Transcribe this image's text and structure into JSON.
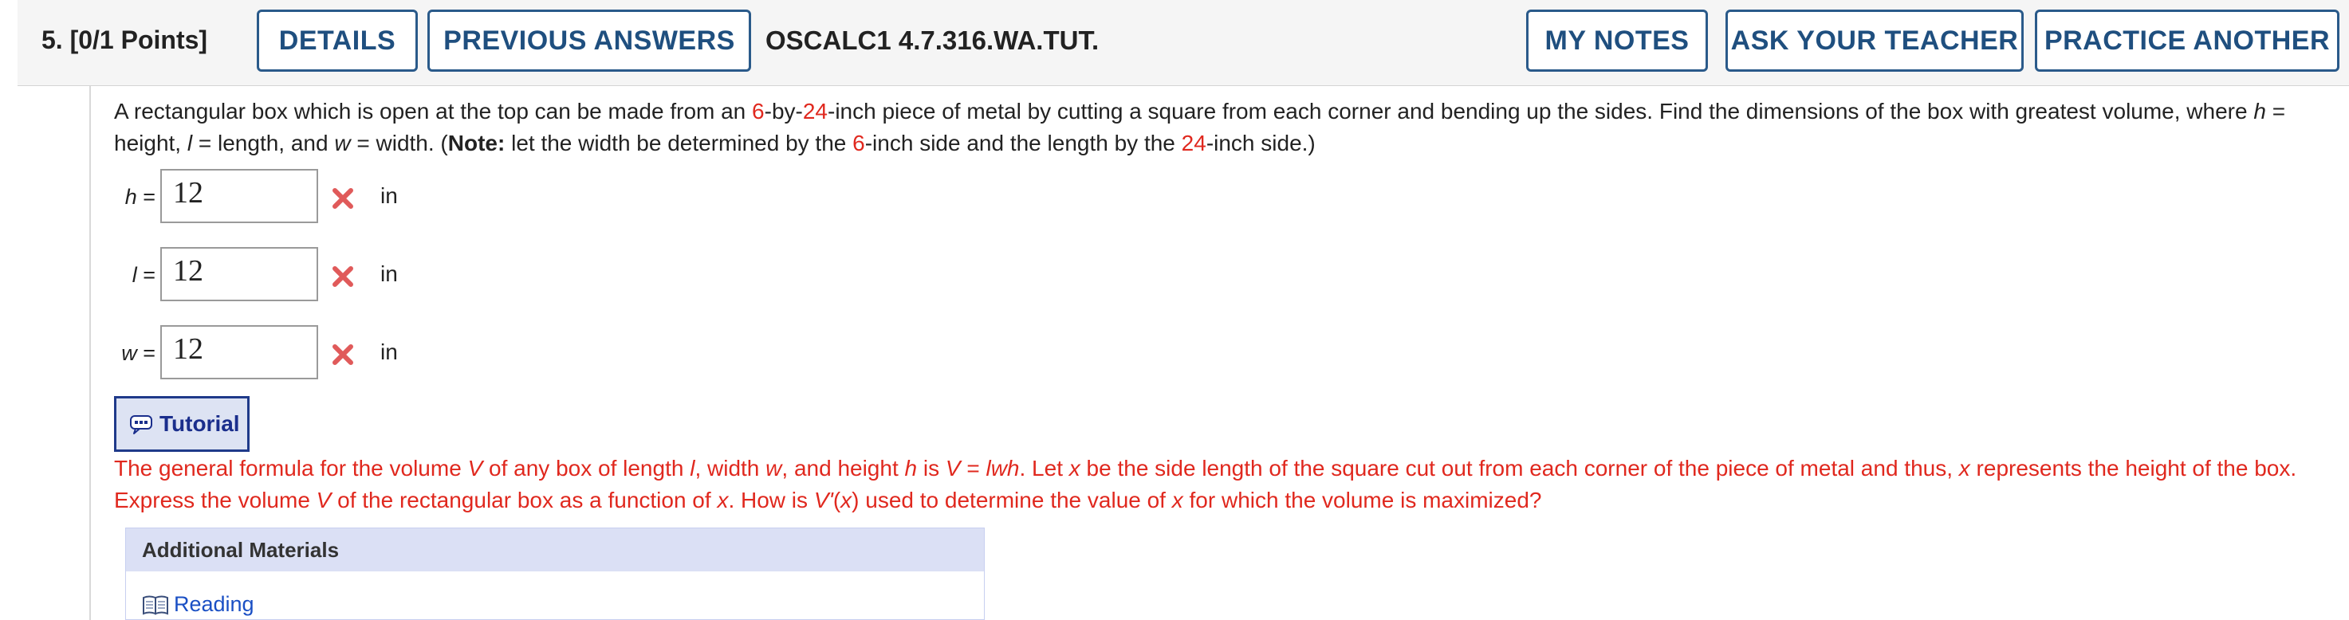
{
  "header": {
    "question_number": "5.",
    "points": "[0/1 Points]",
    "details_label": "DETAILS",
    "previous_answers_label": "PREVIOUS ANSWERS",
    "assignment_code": "OSCALC1 4.7.316.WA.TUT.",
    "my_notes_label": "MY NOTES",
    "ask_teacher_label": "ASK YOUR TEACHER",
    "practice_another_label": "PRACTICE ANOTHER"
  },
  "question": {
    "t1": "A rectangular box which is open at the top can be made from an ",
    "n6a": "6",
    "t2": "-by-",
    "n24a": "24",
    "t3": "-inch piece of metal by cutting a square from each corner and bending up the sides. Find the dimensions of the box with greatest volume, where ",
    "h": "h",
    "t4": " = height, ",
    "l": "l",
    "t5": " = length, and ",
    "w": "w",
    "t6": " = width. (",
    "note": "Note:",
    "t7": " let the width be determined by the ",
    "n6b": "6",
    "t8": "-inch side and the length by the ",
    "n24b": "24",
    "t9": "-inch side.)"
  },
  "answers": [
    {
      "var": "h",
      "eq": " =",
      "value": "12",
      "unit": "in",
      "status": "incorrect"
    },
    {
      "var": "l",
      "eq": " =",
      "value": "12",
      "unit": "in",
      "status": "incorrect"
    },
    {
      "var": "w",
      "eq": " =",
      "value": "12",
      "unit": "in",
      "status": "incorrect"
    }
  ],
  "tutorial": {
    "label": "Tutorial",
    "icon": "calculator-chat-icon",
    "hint": {
      "a": "The general formula for the volume ",
      "V1": "V",
      "b": " of any box of length ",
      "l": "l",
      "c": ", width ",
      "w": "w",
      "d": ", and height ",
      "h": "h",
      "e": " is ",
      "V2": "V",
      "f": " = ",
      "lwh": "lwh",
      "g": ". Let ",
      "x1": "x",
      "i": " be the side length of the square cut out from each corner of the piece of metal and thus, ",
      "x2": "x",
      "j": " represents the height of the box. Express the volume ",
      "V3": "V",
      "k": " of the rectangular box as a function of ",
      "x3": "x",
      "m": ". How is ",
      "Vp": "V'",
      "n": "(",
      "x4": "x",
      "o": ") used to determine the value of ",
      "x5": "x",
      "p": " for which the volume is maximized?"
    }
  },
  "additional_materials": {
    "title": "Additional Materials",
    "items": [
      {
        "label": "Reading",
        "icon": "book-icon"
      }
    ]
  },
  "colors": {
    "accent_blue": "#1f4f7f",
    "error_red": "#e0281e",
    "x_mark": "#e05a5a",
    "panel_blue": "#dbe0f5"
  }
}
